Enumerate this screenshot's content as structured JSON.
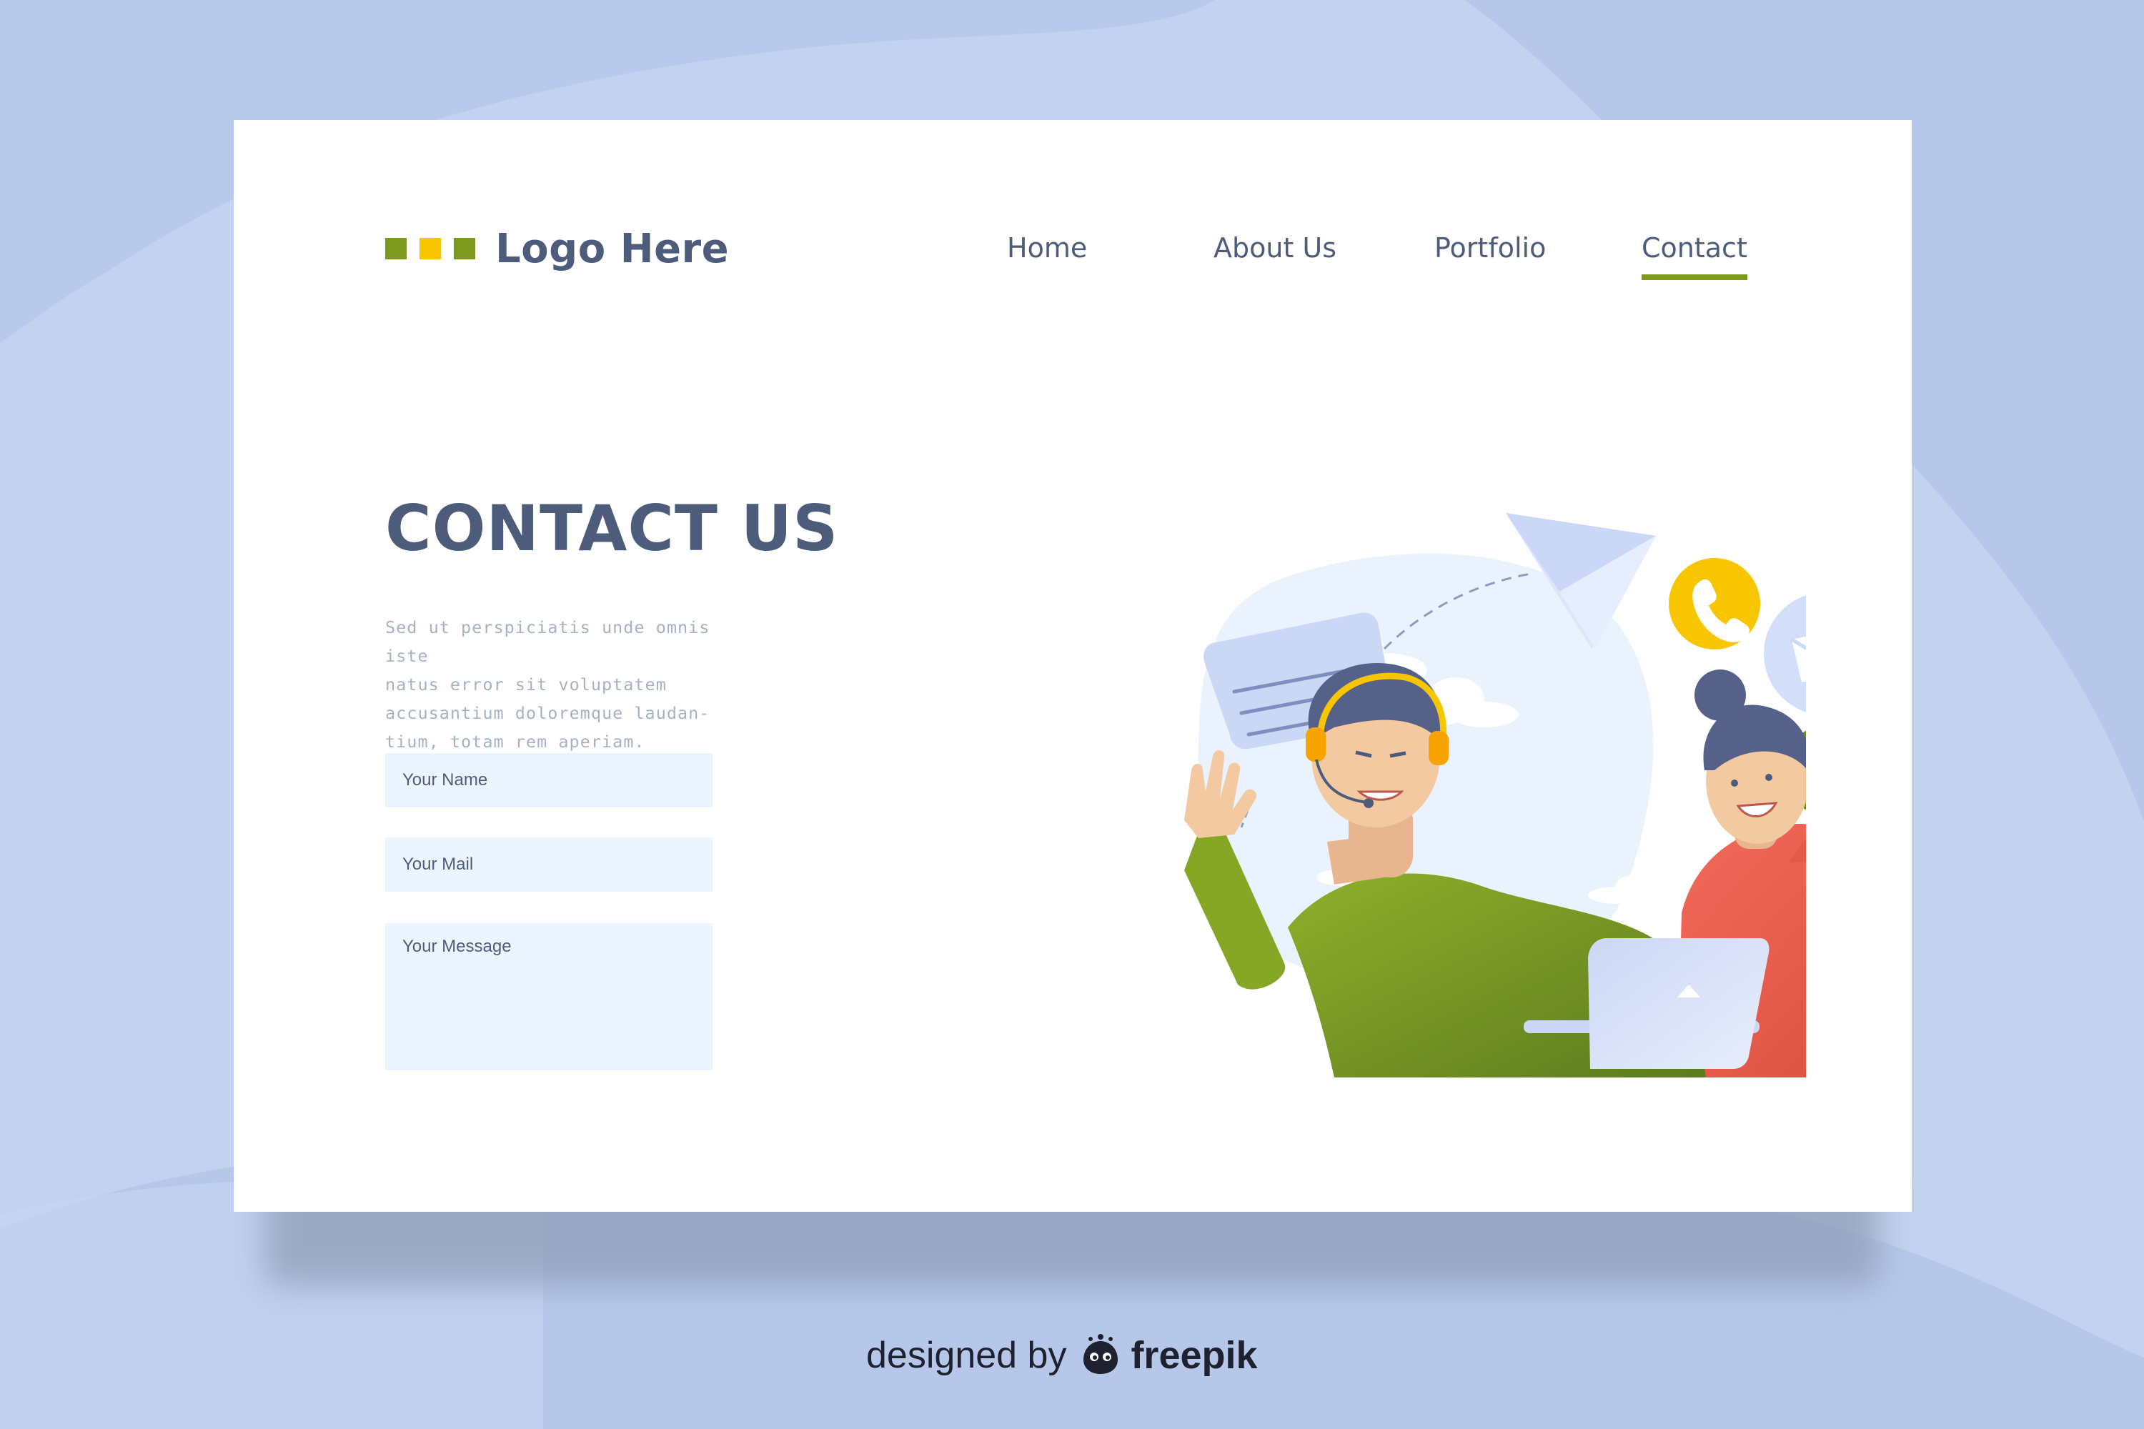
{
  "colors": {
    "background": "#c3d2ef",
    "card": "#ffffff",
    "text_primary": "#4e5c7c",
    "text_muted": "#a6b1c4",
    "accent_green": "#7e9a1e",
    "accent_yellow": "#f7c600",
    "input_bg": "#ecf5ff"
  },
  "header": {
    "logo": {
      "text": "Logo Here",
      "squares": [
        "#7e9a1e",
        "#f7c600",
        "#7e9a1e"
      ]
    },
    "nav": [
      {
        "label": "Home",
        "active": false
      },
      {
        "label": "About Us",
        "active": false
      },
      {
        "label": "Portfolio",
        "active": false
      },
      {
        "label": "Contact",
        "active": true
      }
    ]
  },
  "hero": {
    "title": "CONTACT US",
    "body_lines": [
      "Sed ut perspiciatis unde omnis iste",
      "natus error sit voluptatem",
      "accusantium doloremque laudan-",
      "tium, totam rem aperiam."
    ]
  },
  "form": {
    "name_placeholder": "Your Name",
    "mail_placeholder": "Your Mail",
    "message_placeholder": "Your Message"
  },
  "illustration": {
    "icons": [
      "paper-plane-icon",
      "chat-bubble-icon",
      "phone-icon",
      "mail-icon",
      "globe-icon",
      "laptop-icon",
      "cloud-icon"
    ]
  },
  "credit": {
    "prefix": "designed by",
    "brand": "freepik"
  }
}
